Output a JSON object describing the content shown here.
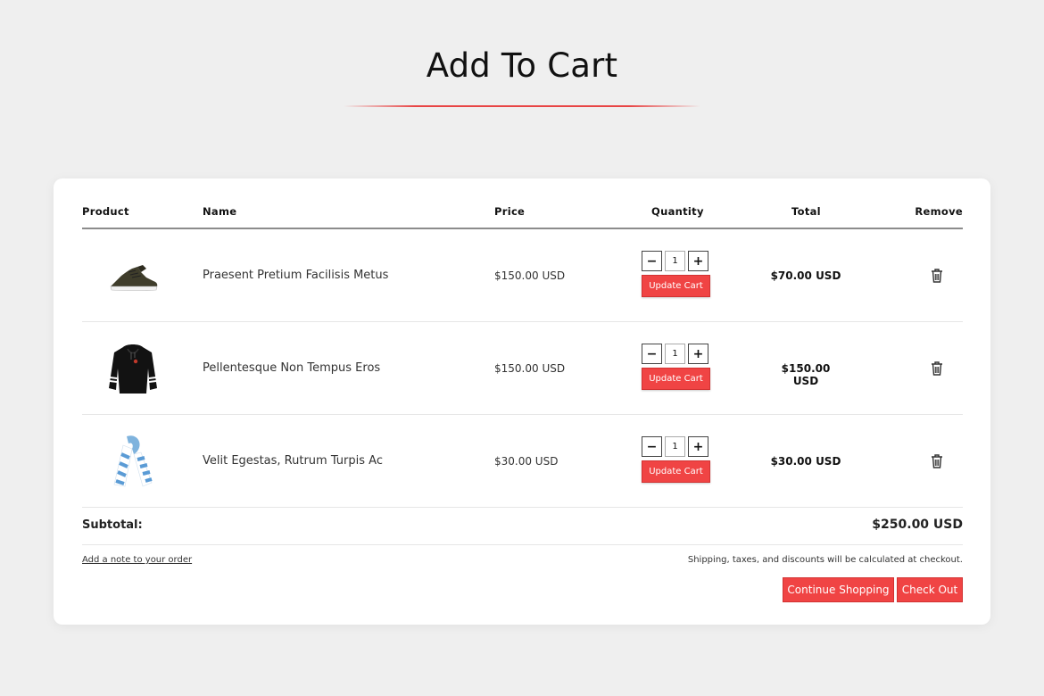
{
  "page": {
    "title": "Add To Cart"
  },
  "colors": {
    "accent": "#f04444",
    "background": "#efefef",
    "card": "#ffffff"
  },
  "table": {
    "headers": {
      "product": "Product",
      "name": "Name",
      "price": "Price",
      "quantity": "Quantity",
      "total": "Total",
      "remove": "Remove"
    },
    "rows": [
      {
        "image": "sneaker-image",
        "name": "Praesent Pretium Facilisis Metus",
        "price": "$150.00 USD",
        "quantity": "1",
        "update_label": "Update Cart",
        "total": "$70.00 USD",
        "remove_icon": "trash-icon"
      },
      {
        "image": "hoodie-image",
        "name": "Pellentesque Non Tempus Eros",
        "price": "$150.00 USD",
        "quantity": "1",
        "update_label": "Update Cart",
        "total": "$150.00 USD",
        "remove_icon": "trash-icon"
      },
      {
        "image": "scarf-image",
        "name": "Velit Egestas, Rutrum Turpis Ac",
        "price": "$30.00 USD",
        "quantity": "1",
        "update_label": "Update Cart",
        "total": "$30.00 USD",
        "remove_icon": "trash-icon"
      }
    ],
    "stepper": {
      "minus": "−",
      "plus": "+"
    }
  },
  "summary": {
    "subtotal_label": "Subtotal:",
    "subtotal_value": "$250.00 USD",
    "note_link": "Add a note to your order",
    "shipping_note": "Shipping, taxes, and discounts will be calculated at checkout.",
    "continue_label": "Continue Shopping",
    "checkout_label": "Check Out"
  }
}
